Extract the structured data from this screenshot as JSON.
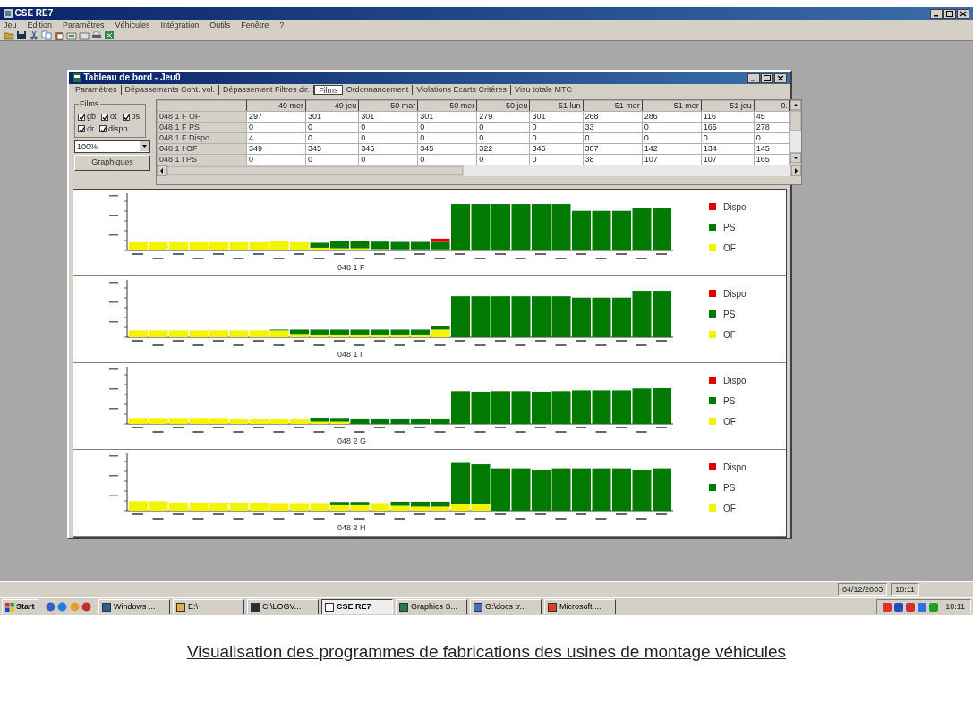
{
  "app": {
    "title": "CSE RE7"
  },
  "menu": [
    "Jeu",
    "Edition",
    "Paramètres",
    "Véhicules",
    "Intégration",
    "Outils",
    "Fenêtre",
    "?"
  ],
  "document_window": {
    "title": "Tableau de bord - Jeu0",
    "tabs": [
      {
        "label": "Paramètres",
        "selected": false
      },
      {
        "label": "Dépassements Cont. vol.",
        "selected": false
      },
      {
        "label": "Dépassement Filtres dir.",
        "selected": false
      },
      {
        "label": "Films",
        "selected": true
      },
      {
        "label": "Ordonnancement",
        "selected": false
      },
      {
        "label": "Violations Ecarts Critères",
        "selected": false
      },
      {
        "label": "Visu totale MTC",
        "selected": false
      }
    ],
    "filter_group": {
      "label": "Films",
      "options": [
        {
          "label": "gb",
          "checked": true
        },
        {
          "label": "ot",
          "checked": true
        },
        {
          "label": "ps",
          "checked": true
        },
        {
          "label": "dr",
          "checked": true
        },
        {
          "label": "dispo",
          "checked": true
        }
      ]
    },
    "zoom_combo": {
      "value": "100%"
    },
    "graph_button": "Graphiques",
    "grid": {
      "columns": [
        "49 mer",
        "49 jeu",
        "50 mar",
        "50 mer",
        "50 jeu",
        "51 lun",
        "51 mer",
        "51 mer",
        "51 jeu",
        "0."
      ],
      "rows": [
        {
          "label": "048 1 F OF",
          "cells": [
            "297",
            "301",
            "301",
            "301",
            "279",
            "301",
            "268",
            "286",
            "116",
            "45"
          ]
        },
        {
          "label": "048 1 F PS",
          "cells": [
            "0",
            "0",
            "0",
            "0",
            "0",
            "0",
            "33",
            "0",
            "165",
            "278"
          ]
        },
        {
          "label": "048 1 F Dispo",
          "cells": [
            "4",
            "0",
            "0",
            "0",
            "0",
            "0",
            "0",
            "0",
            "0",
            "0"
          ]
        },
        {
          "label": "048 1 I OF",
          "cells": [
            "349",
            "345",
            "345",
            "345",
            "322",
            "345",
            "307",
            "142",
            "134",
            "145"
          ]
        },
        {
          "label": "048 1 I PS",
          "cells": [
            "0",
            "0",
            "0",
            "0",
            "0",
            "0",
            "38",
            "107",
            "107",
            "165"
          ]
        }
      ]
    },
    "charts": [
      {
        "title": "048 1 F",
        "legend": [
          {
            "label": "Dispo",
            "color": "#e00000"
          },
          {
            "label": "PS",
            "color": "#007a00"
          },
          {
            "label": "OF",
            "color": "#f4f400"
          }
        ]
      },
      {
        "title": "048 1 I",
        "legend": [
          {
            "label": "Dispo",
            "color": "#e00000"
          },
          {
            "label": "PS",
            "color": "#007a00"
          },
          {
            "label": "OF",
            "color": "#f4f400"
          }
        ]
      },
      {
        "title": "048 2 G",
        "legend": [
          {
            "label": "Dispo",
            "color": "#e00000"
          },
          {
            "label": "PS",
            "color": "#007a00"
          },
          {
            "label": "OF",
            "color": "#f4f400"
          }
        ]
      },
      {
        "title": "048 2 H",
        "legend": [
          {
            "label": "Dispo",
            "color": "#e00000"
          },
          {
            "label": "PS",
            "color": "#007a00"
          },
          {
            "label": "OF",
            "color": "#f4f400"
          }
        ]
      }
    ]
  },
  "status_bar": {
    "date": "04/12/2003",
    "time": "18:11"
  },
  "taskbar": {
    "start": "Start",
    "tasks": [
      {
        "label": "Windows ...",
        "selected": false
      },
      {
        "label": "E:\\",
        "selected": false
      },
      {
        "label": "C:\\LOGV...",
        "selected": false
      },
      {
        "label": "CSE RE7",
        "selected": true
      },
      {
        "label": "Graphics S...",
        "selected": false
      },
      {
        "label": "G:\\docs tr...",
        "selected": false
      },
      {
        "label": "Microsoft ...",
        "selected": false
      }
    ],
    "clock": "18:11"
  },
  "caption": "Visualisation des programmes de fabrications des usines de montage véhicules"
}
